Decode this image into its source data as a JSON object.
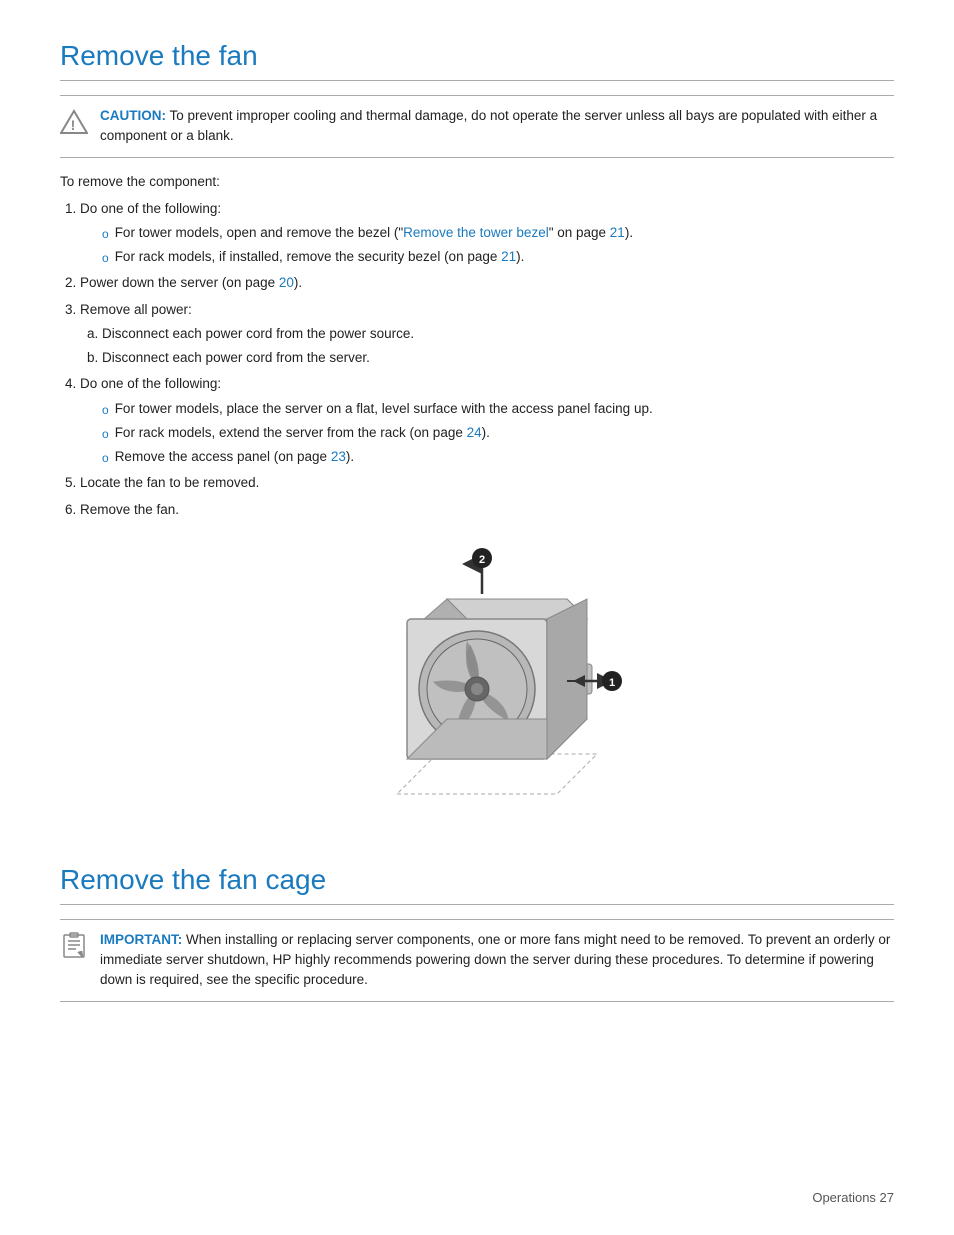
{
  "page": {
    "title1": "Remove the fan",
    "title2": "Remove the fan cage",
    "footer": "Operations    27"
  },
  "caution": {
    "label": "CAUTION:",
    "text": "To prevent improper cooling and thermal damage, do not operate the server unless all bays are populated with either a component or a blank."
  },
  "important": {
    "label": "IMPORTANT:",
    "text": "When installing or replacing server components, one or more fans might need to be removed. To prevent an orderly or immediate server shutdown, HP highly recommends powering down the server during these procedures. To determine if powering down is required, see the specific procedure."
  },
  "intro": "To remove the component:",
  "steps": [
    {
      "num": "1.",
      "text": "Do one of the following:",
      "bullets": [
        "For tower models, open and remove the bezel (“Remove the tower bezel” on page 21).",
        "For rack models, if installed, remove the security bezel (on page 21)."
      ],
      "link_text": "Remove the tower bezel",
      "link_page": "21"
    },
    {
      "num": "2.",
      "text": "Power down the server (on page 20).",
      "bullets": [],
      "subitems": []
    },
    {
      "num": "3.",
      "text": "Remove all power:",
      "bullets": [],
      "subitems": [
        "Disconnect each power cord from the power source.",
        "Disconnect each power cord from the server."
      ]
    },
    {
      "num": "4.",
      "text": "Do one of the following:",
      "bullets": [
        "For tower models, place the server on a flat, level surface with the access panel facing up.",
        "For rack models, extend the server from the rack (on page 24).",
        "Remove the access panel (on page 23)."
      ]
    },
    {
      "num": "5.",
      "text": "Locate the fan to be removed.",
      "bullets": []
    },
    {
      "num": "6.",
      "text": "Remove the fan.",
      "bullets": []
    }
  ],
  "diagram": {
    "label1": "1",
    "label2": "2"
  }
}
